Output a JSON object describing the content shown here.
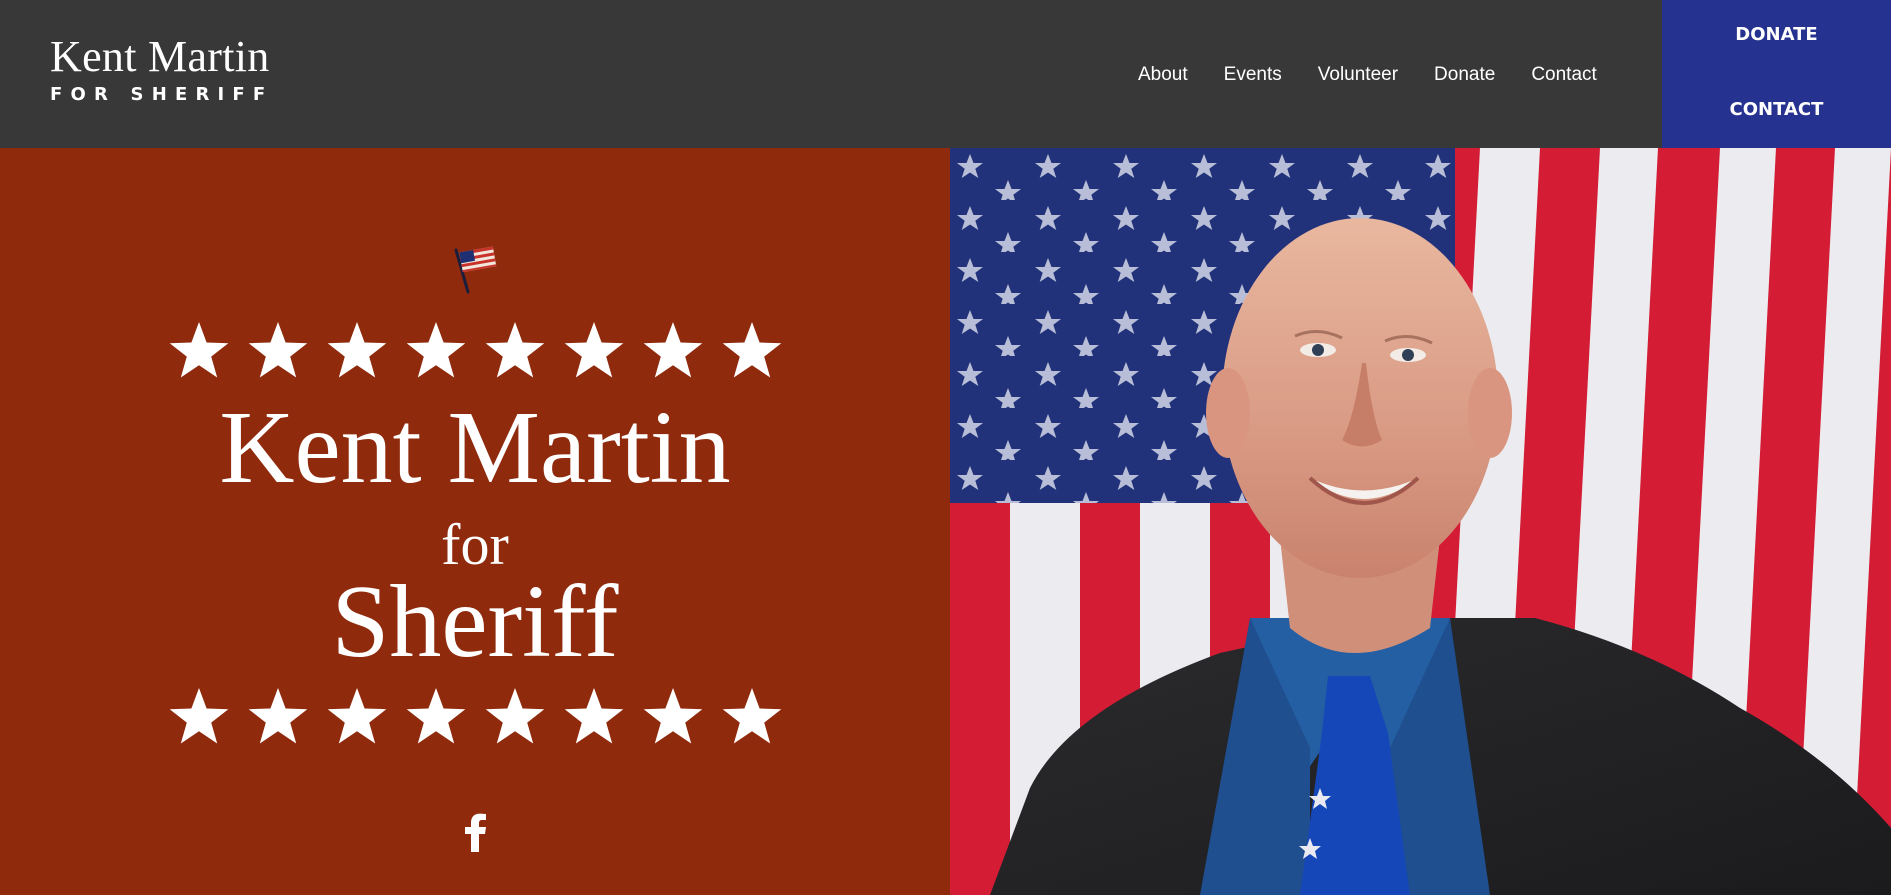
{
  "header": {
    "logo": {
      "name": "Kent Martin",
      "subtitle": "FOR SHERIFF"
    },
    "nav": [
      "About",
      "Events",
      "Volunteer",
      "Donate",
      "Contact"
    ],
    "cta": {
      "donate": "DONATE",
      "contact": "CONTACT"
    }
  },
  "hero": {
    "line1": "Kent Martin",
    "line2": "for",
    "line3": "Sheriff",
    "icons": [
      "flag-icon",
      "star-icon",
      "facebook-icon"
    ],
    "colors": {
      "left_panel": "#8f2a0d",
      "header": "#383838",
      "cta": "#26328f"
    }
  }
}
